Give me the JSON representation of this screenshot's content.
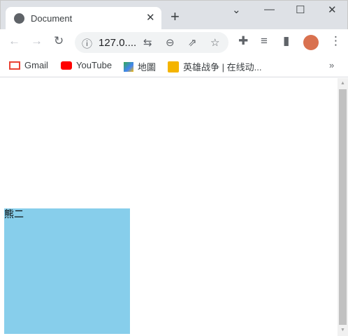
{
  "tab": {
    "title": "Document",
    "close": "✕",
    "new_tab": "+"
  },
  "window": {
    "dropdown": "⌄",
    "minimize": "—",
    "maximize": "☐",
    "close": "✕"
  },
  "toolbar": {
    "back": "←",
    "forward": "→",
    "reload": "↻",
    "url": "127.0....",
    "info": "ⓘ",
    "translate": "⇆",
    "zoom": "⊖",
    "share": "⇗",
    "star": "☆",
    "extensions": "✚",
    "media": "≡",
    "sidepanel": "▮",
    "menu": "⋮"
  },
  "bookmarks": {
    "items": [
      {
        "label": "Gmail",
        "color": "#ea4335"
      },
      {
        "label": "YouTube",
        "color": "#ff0000"
      },
      {
        "label": "地圖",
        "color": "#34a853"
      },
      {
        "label": "英雄战争 | 在线动...",
        "color": "#f4b400"
      }
    ],
    "more": "»"
  },
  "page": {
    "box_text": "熊二",
    "box_color": "#87ceeb"
  }
}
